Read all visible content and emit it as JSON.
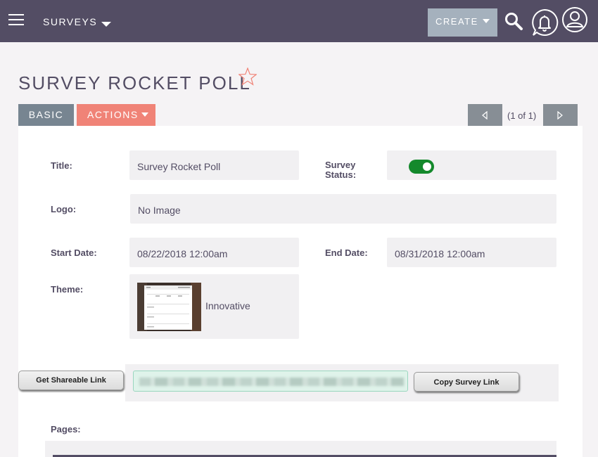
{
  "nav": {
    "module": "SURVEYS",
    "create": "CREATE"
  },
  "record": {
    "title": "SURVEY ROCKET POLL"
  },
  "tabs": {
    "basic": "BASIC",
    "actions": "ACTIONS"
  },
  "pager": {
    "count": "(1 of 1)"
  },
  "fields": {
    "title_label": "Title:",
    "title_value": "Survey Rocket Poll",
    "status_label": "Survey Status:",
    "status_on": true,
    "logo_label": "Logo:",
    "logo_value": "No Image",
    "start_label": "Start Date:",
    "start_value": "08/22/2018 12:00am",
    "end_label": "End Date:",
    "end_value": "08/31/2018 12:00am",
    "theme_label": "Theme:",
    "theme_value": "Innovative",
    "pages_label": "Pages:"
  },
  "share": {
    "get_link": "Get Shareable Link",
    "copy_link": "Copy Survey Link"
  },
  "colors": {
    "topbar": "#534d64",
    "create_button": "#a5b1bd",
    "tab_basic": "#778591",
    "tab_actions": "#f08377",
    "toggle_on": "#14892c",
    "favorite_star": "#f08377"
  },
  "icons": [
    "hamburger-icon",
    "chevron-down-icon",
    "search-icon",
    "bell-icon",
    "user-icon",
    "star-icon",
    "triangle-left-icon",
    "triangle-right-icon"
  ]
}
